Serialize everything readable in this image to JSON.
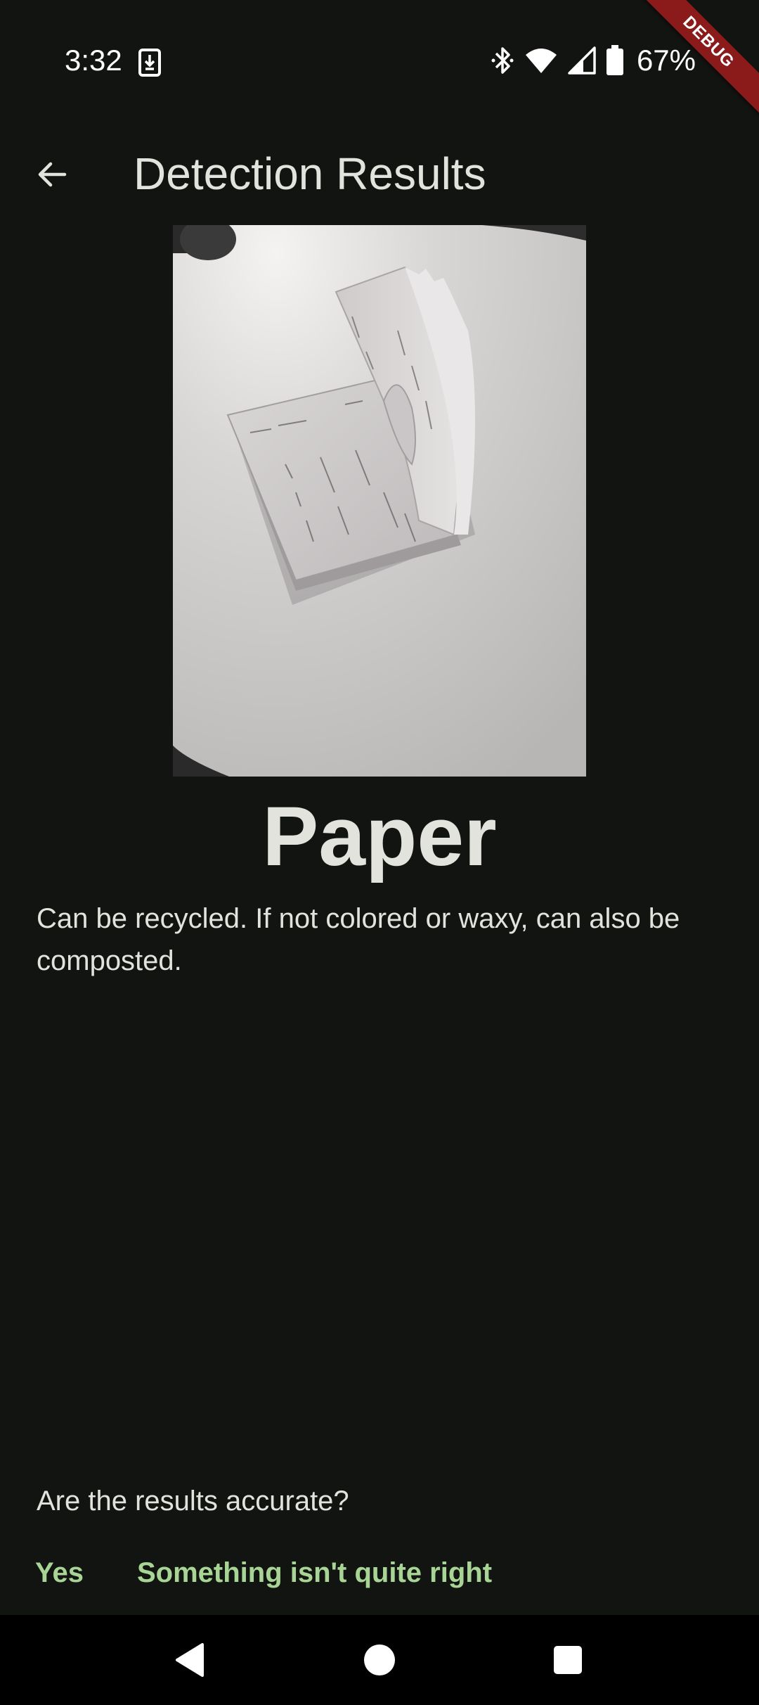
{
  "status_bar": {
    "time": "3:32",
    "battery_percent": "67%",
    "icons": [
      "download-icon",
      "bluetooth-icon",
      "wifi-icon",
      "signal-icon",
      "battery-icon"
    ]
  },
  "debug_banner": "DEBUG",
  "app_bar": {
    "title": "Detection Results",
    "back_icon": "arrow-back-icon"
  },
  "result": {
    "label": "Paper",
    "description": "Can be recycled. If not colored or waxy, can also be composted."
  },
  "feedback": {
    "question": "Are the results accurate?",
    "yes_label": "Yes",
    "no_label": "Something isn't quite right"
  },
  "colors": {
    "background": "#121411",
    "text": "#e2e3dd",
    "accent": "#a8d595",
    "debug": "#8b1a1a"
  },
  "nav_bar": {
    "icons": [
      "back-triangle-icon",
      "home-circle-icon",
      "recents-square-icon"
    ]
  }
}
